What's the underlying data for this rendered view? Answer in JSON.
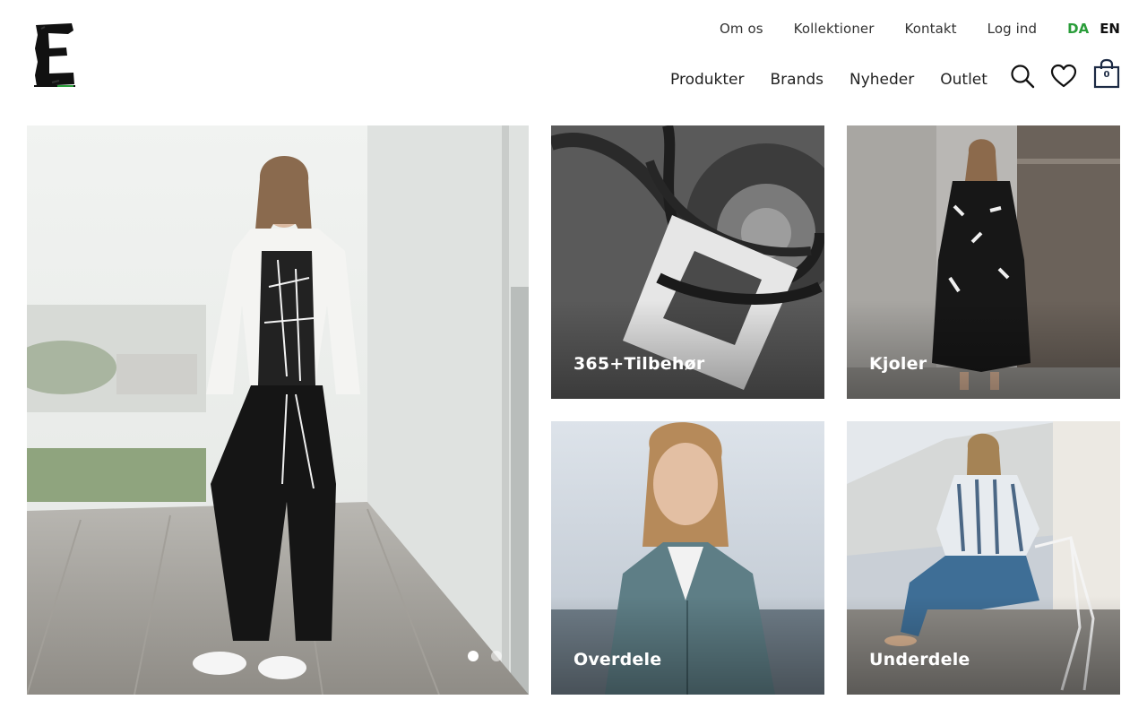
{
  "header": {
    "logo_alt": "E",
    "top_links": [
      "Om os",
      "Kollektioner",
      "Kontakt",
      "Log ind"
    ],
    "languages": [
      {
        "code": "DA",
        "color": "#2a9d3a"
      },
      {
        "code": "EN",
        "color": "#111111"
      }
    ],
    "main_nav": [
      "Produkter",
      "Brands",
      "Nyheder",
      "Outlet"
    ],
    "icons": [
      "search-icon",
      "heart-icon",
      "shopping-bag-icon"
    ],
    "cart_count": "0"
  },
  "hero": {
    "slides": 2,
    "active_slide": 1
  },
  "categories": [
    {
      "label": "365+Tilbehør"
    },
    {
      "label": "Kjoler"
    },
    {
      "label": "Overdele"
    },
    {
      "label": "Underdele"
    }
  ],
  "colors": {
    "accent_green": "#2a9d3a",
    "cart_navy": "#1c2a44"
  }
}
